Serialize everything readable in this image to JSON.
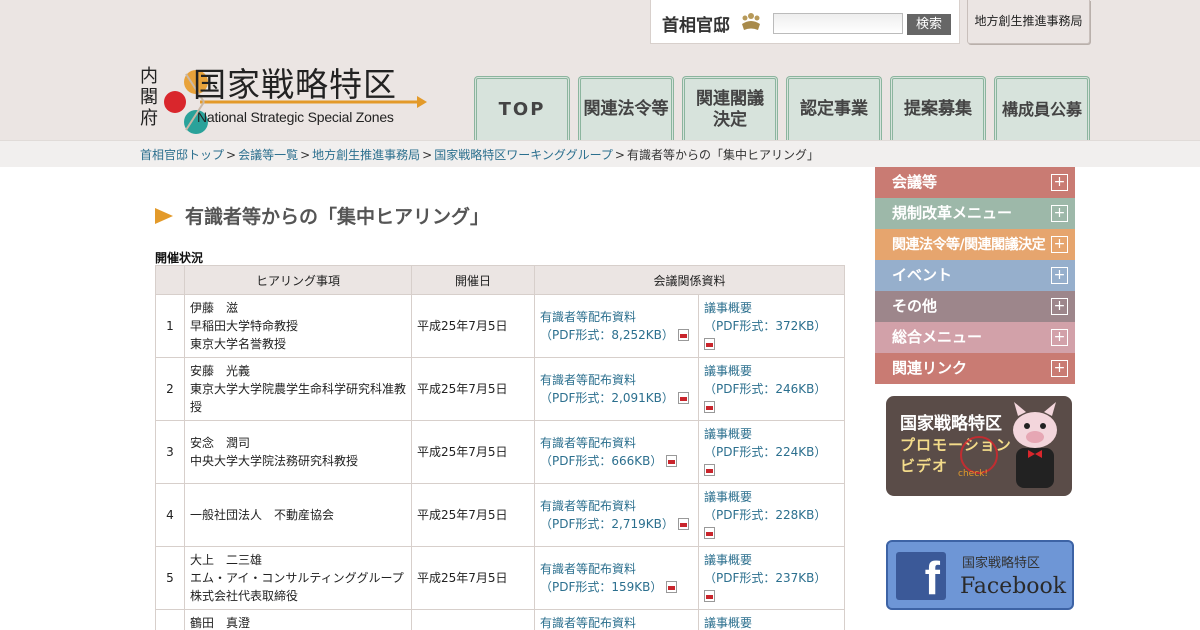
{
  "header": {
    "site_name": "首相官邸",
    "search_button": "検索",
    "search_placeholder": "",
    "office_link": "地方創生推進事務局"
  },
  "logo": {
    "cabinet": "内閣府",
    "title": "国家戦略特区",
    "subtitle": "National Strategic Special Zones"
  },
  "nav": {
    "tabs": [
      {
        "label": "TOP"
      },
      {
        "label": "関連法令等"
      },
      {
        "label": "関連閣議\n決定"
      },
      {
        "label": "認定事業"
      },
      {
        "label": "提案募集"
      },
      {
        "label": "構成員公募"
      }
    ]
  },
  "breadcrumb": {
    "items": [
      "首相官邸トップ",
      "会議等一覧",
      "地方創生推進事務局",
      "国家戦略特区ワーキンググループ"
    ],
    "separator": ">",
    "current": "有識者等からの「集中ヒアリング」"
  },
  "main": {
    "title": "有識者等からの「集中ヒアリング」",
    "section_label": "開催状況",
    "table": {
      "headers": [
        "",
        "ヒアリング事項",
        "開催日",
        "会議関係資料"
      ],
      "rows": [
        {
          "no": "1",
          "name": "伊藤　滋\n早稲田大学特命教授\n東京大学名誉教授",
          "date": "平成25年7月5日",
          "material": "有識者等配布資料",
          "material_size": "（PDF形式：8,252KB）",
          "summary": "議事概要",
          "summary_size": "（PDF形式：372KB）"
        },
        {
          "no": "2",
          "name": "安藤　光義\n東京大学大学院農学生命科学研究科准教授",
          "date": "平成25年7月5日",
          "material": "有識者等配布資料",
          "material_size": "（PDF形式：2,091KB）",
          "summary": "議事概要",
          "summary_size": "（PDF形式：246KB）"
        },
        {
          "no": "3",
          "name": "安念　潤司\n中央大学大学院法務研究科教授",
          "date": "平成25年7月5日",
          "material": "有識者等配布資料",
          "material_size": "（PDF形式：666KB）",
          "summary": "議事概要",
          "summary_size": "（PDF形式：224KB）"
        },
        {
          "no": "4",
          "name": "一般社団法人　不動産協会",
          "date": "平成25年7月5日",
          "material": "有識者等配布資料",
          "material_size": "（PDF形式：2,719KB）",
          "summary": "議事概要",
          "summary_size": "（PDF形式：228KB）"
        },
        {
          "no": "5",
          "name": "大上　二三雄\nエム・アイ・コンサルティンググループ株式会社代表取締役",
          "date": "平成25年7月5日",
          "material": "有識者等配布資料",
          "material_size": "（PDF形式：159KB）",
          "summary": "議事概要",
          "summary_size": "（PDF形式：237KB）"
        },
        {
          "no": "",
          "name": "鶴田　真澄",
          "date": "",
          "material": "有識者等配布資料",
          "material_size": "",
          "summary": "議事概要",
          "summary_size": ""
        }
      ]
    }
  },
  "sidebar": {
    "items": [
      {
        "label": "会議等",
        "color": "#c97b73"
      },
      {
        "label": "規制改革メニュー",
        "color": "#9db8a9"
      },
      {
        "label": "関連法令等/関連閣議決定",
        "color": "#e6a56e"
      },
      {
        "label": "イベント",
        "color": "#96afcc"
      },
      {
        "label": "その他",
        "color": "#9d868b"
      },
      {
        "label": "総合メニュー",
        "color": "#d2a1a9"
      },
      {
        "label": "関連リンク",
        "color": "#c97b73"
      }
    ],
    "promo": {
      "title": "国家戦略特区",
      "subtitle": "プロモーション\nビデオ",
      "badge": "check!"
    },
    "facebook": {
      "top": "国家戦略特区",
      "name": "Facebook"
    }
  },
  "colors": {
    "link": "#2b6f8e",
    "accent": "#e39a2a",
    "nav_bg": "#d7e3dc",
    "header_bg": "#ebe5e3"
  }
}
